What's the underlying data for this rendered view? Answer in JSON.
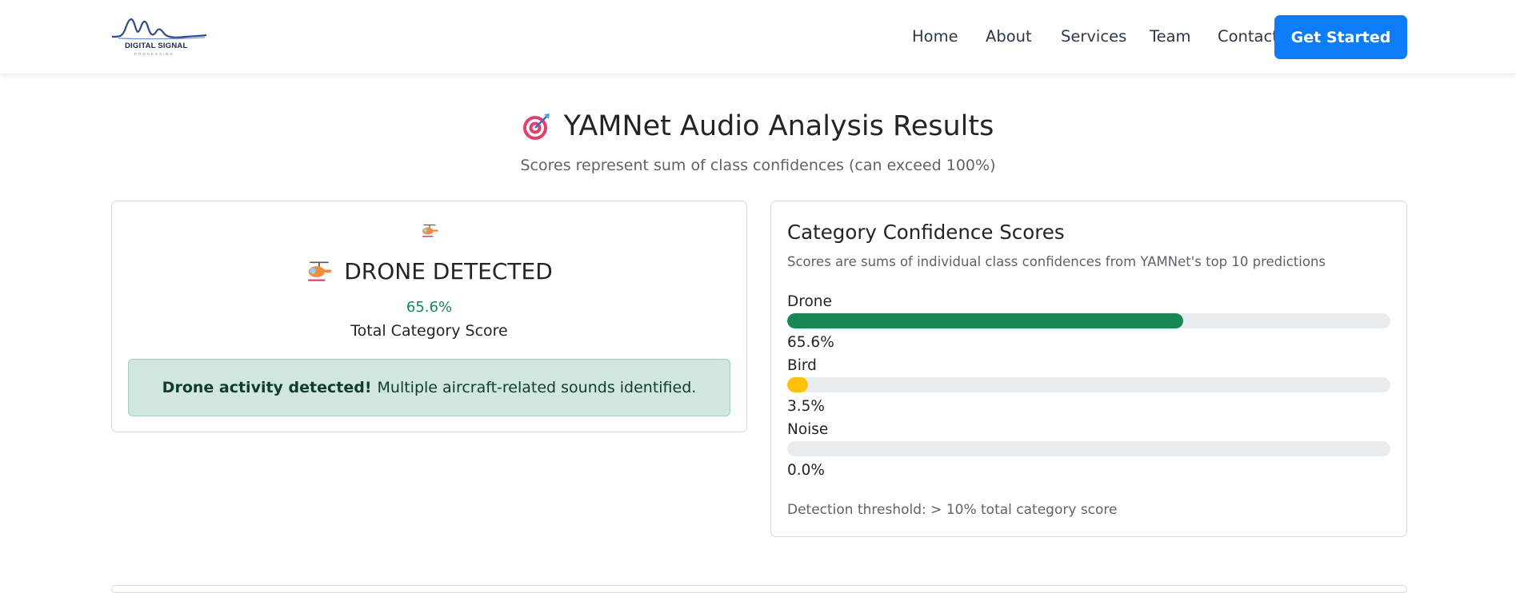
{
  "nav": {
    "logo_text": "DIGITAL SIGNAL",
    "logo_sub": "PROCESSING",
    "links": [
      "Home",
      "About",
      "Services",
      "Team",
      "Contact"
    ],
    "cta": "Get Started"
  },
  "header": {
    "title": "YAMNet Audio Analysis Results",
    "title_icon": "target-icon",
    "subtitle": "Scores represent sum of class confidences (can exceed 100%)"
  },
  "result": {
    "icon": "helicopter-icon",
    "label": "DRONE DETECTED",
    "score": "65.6%",
    "score_label": "Total Category Score",
    "alert_bold": "Drone activity detected!",
    "alert_text": "Multiple aircraft-related sounds identified.",
    "alert_color": "#d1e7dd"
  },
  "scores": {
    "title": "Category Confidence Scores",
    "description": "Scores are sums of individual class confidences from YAMNet's top 10 predictions",
    "categories": [
      {
        "name": "Drone",
        "value": 65.6,
        "value_label": "65.6%",
        "color": "#198754"
      },
      {
        "name": "Bird",
        "value": 3.5,
        "value_label": "3.5%",
        "color": "#ffc107"
      },
      {
        "name": "Noise",
        "value": 0.0,
        "value_label": "0.0%",
        "color": "#6c757d"
      }
    ],
    "threshold": "Detection threshold: > 10% total category score"
  },
  "colors": {
    "primary": "#0d7cf6",
    "success": "#198754",
    "warning": "#ffc107"
  }
}
